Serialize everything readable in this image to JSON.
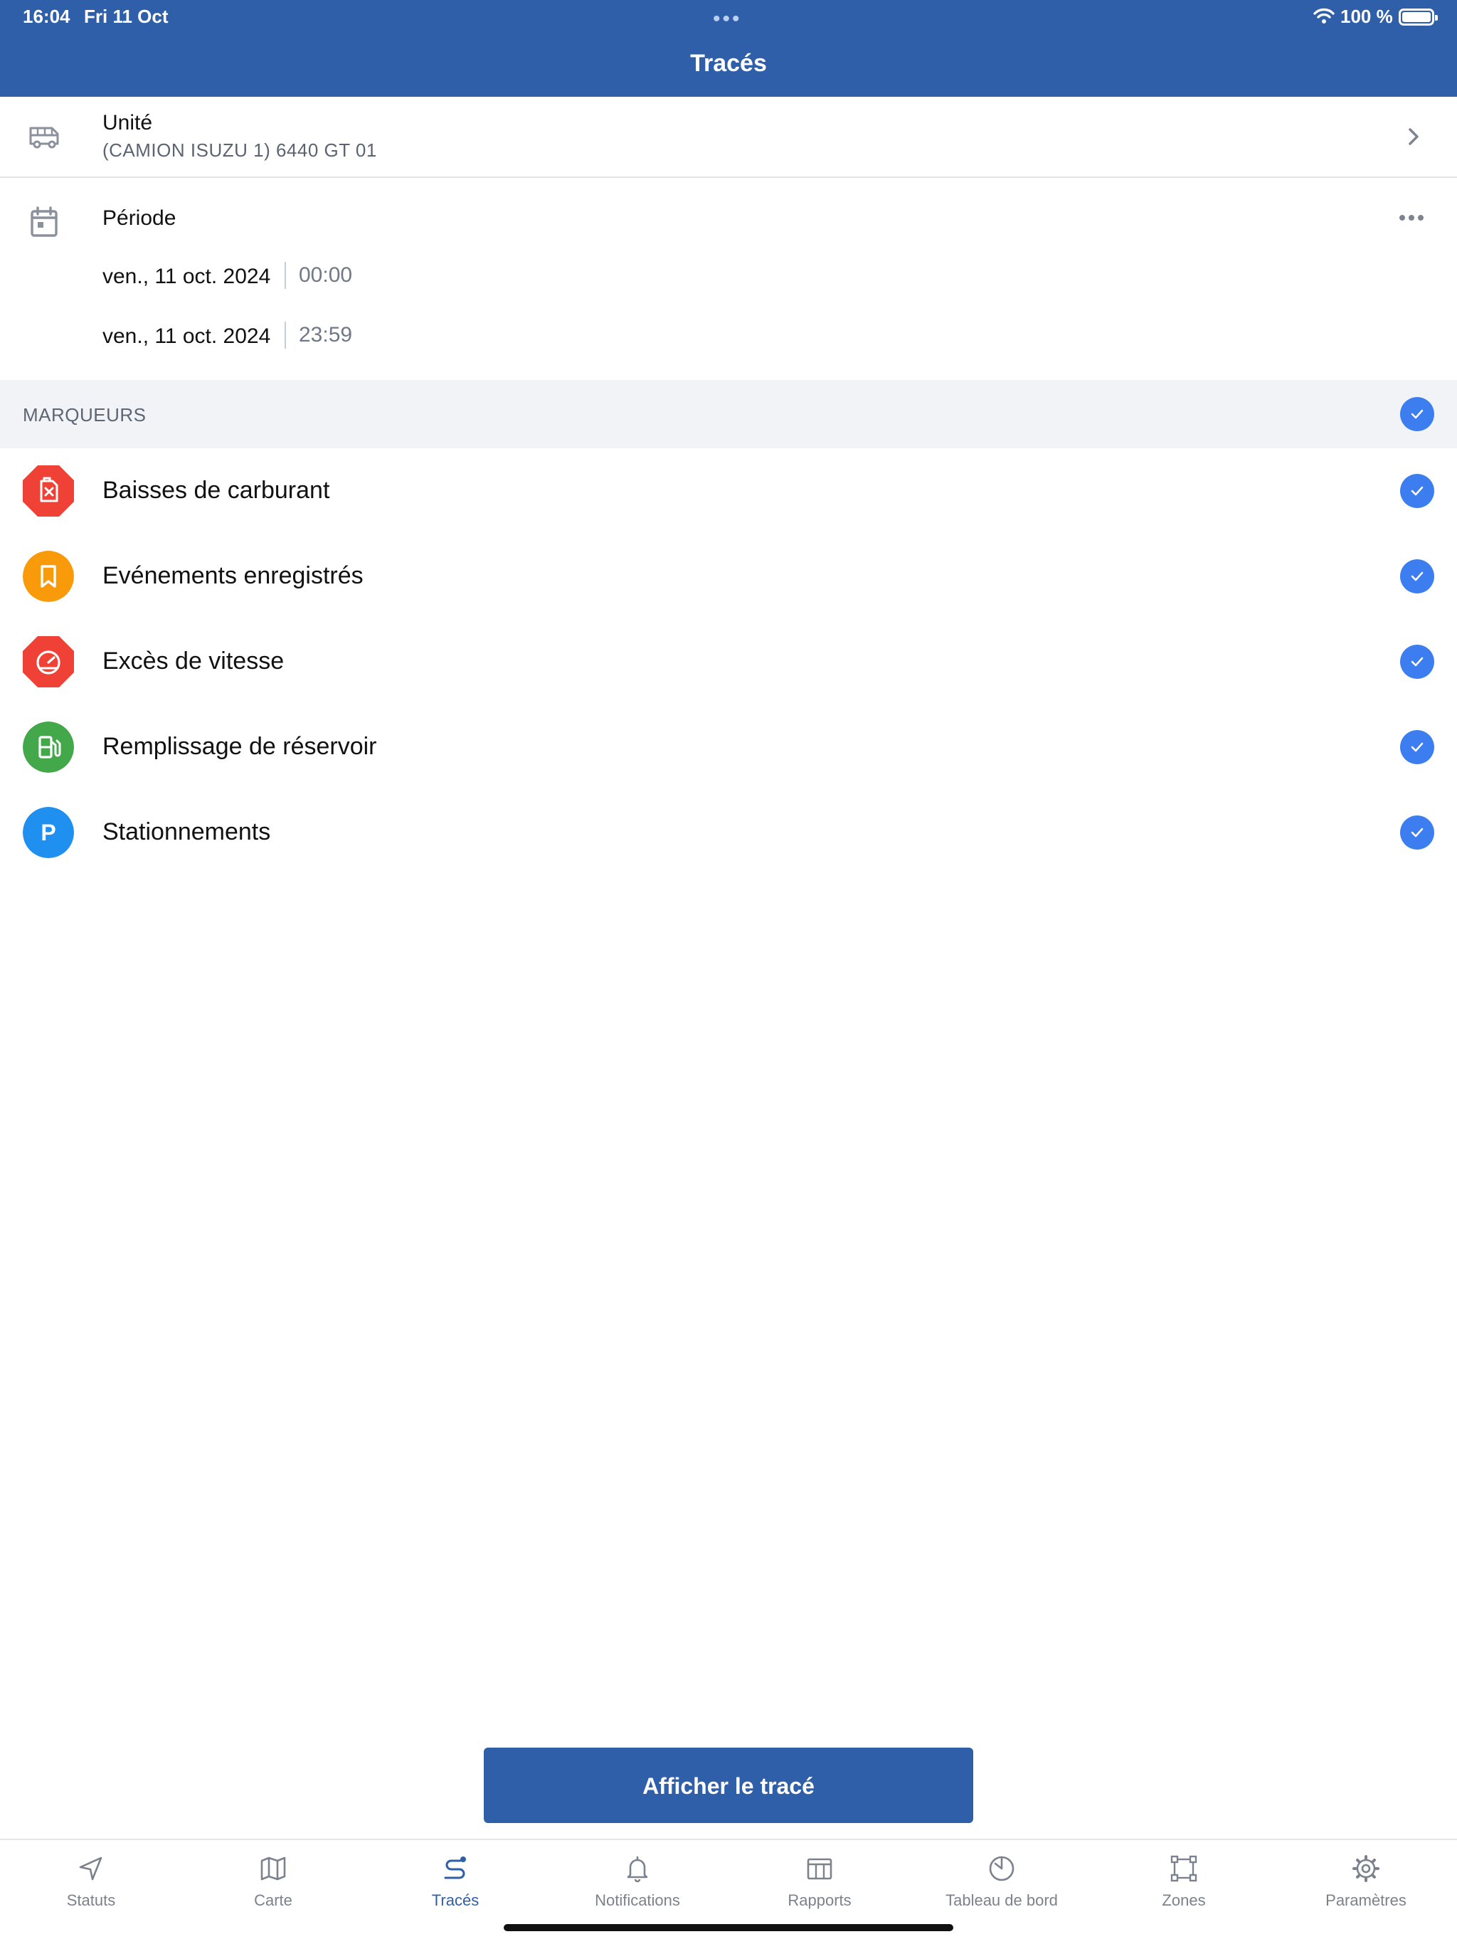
{
  "status_bar": {
    "time": "16:04",
    "date": "Fri 11 Oct",
    "battery": "100 %"
  },
  "header": {
    "title": "Tracés"
  },
  "unit": {
    "title": "Unité",
    "value": "(CAMION ISUZU 1) 6440 GT 01"
  },
  "period": {
    "title": "Période",
    "from_date": "ven., 11 oct. 2024",
    "from_time": "00:00",
    "to_date": "ven., 11 oct. 2024",
    "to_time": "23:59"
  },
  "markers": {
    "section_title": "MARQUEURS",
    "all_checked": true,
    "items": [
      {
        "label": "Baisses de carburant",
        "icon": "fuel-drop-icon",
        "color": "#ef4135",
        "checked": true
      },
      {
        "label": "Evénements enregistrés",
        "icon": "bookmark-icon",
        "color": "#f99a0b",
        "checked": true
      },
      {
        "label": "Excès de vitesse",
        "icon": "speedometer-icon",
        "color": "#ef4135",
        "checked": true
      },
      {
        "label": "Remplissage de réservoir",
        "icon": "fuel-pump-icon",
        "color": "#43a84a",
        "checked": true
      },
      {
        "label": "Stationnements",
        "icon": "parking-icon",
        "color": "#1f8ff0",
        "checked": true
      }
    ],
    "parking_letter": "P"
  },
  "action": {
    "show_button": "Afficher le tracé"
  },
  "tabs": [
    {
      "label": "Statuts",
      "icon": "navigation-arrow-icon",
      "active": false
    },
    {
      "label": "Carte",
      "icon": "map-icon",
      "active": false
    },
    {
      "label": "Tracés",
      "icon": "route-icon",
      "active": true
    },
    {
      "label": "Notifications",
      "icon": "bell-icon",
      "active": false
    },
    {
      "label": "Rapports",
      "icon": "report-table-icon",
      "active": false
    },
    {
      "label": "Tableau de bord",
      "icon": "dashboard-clock-icon",
      "active": false
    },
    {
      "label": "Zones",
      "icon": "zones-polygon-icon",
      "active": false
    },
    {
      "label": "Paramètres",
      "icon": "gear-icon",
      "active": false
    }
  ],
  "colors": {
    "brand": "#2f5fa9",
    "check": "#3c7ef0"
  }
}
